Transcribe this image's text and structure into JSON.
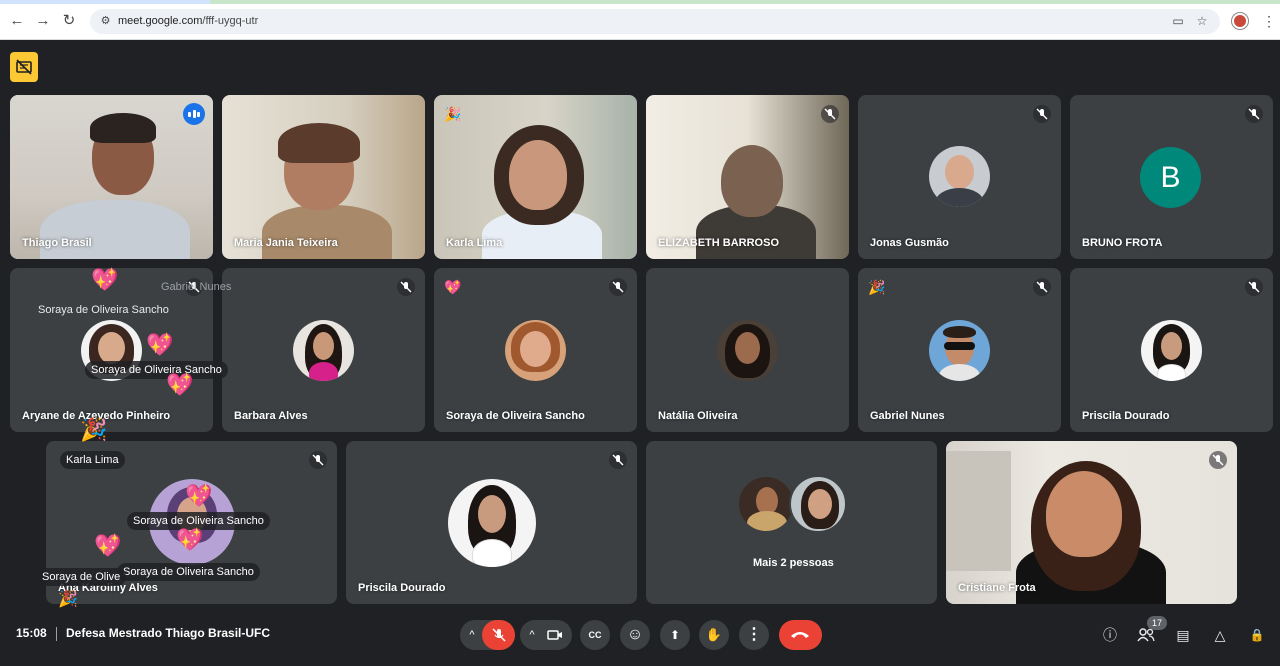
{
  "browser": {
    "url_host": "meet.google.com",
    "url_path": "/fff-uygq-utr",
    "back_icon": "←",
    "forward_icon": "→",
    "reload_icon": "↻",
    "site_info_icon": "⚙",
    "camera_icon": "▭",
    "star_icon": "☆",
    "kebab_icon": "⋮"
  },
  "tiles": {
    "r1": [
      "Thiago Brasil",
      "Maria Jania Teixeira",
      "Karla Lima",
      "ELIZABETH BARROSO",
      "Jonas Gusmão",
      "BRUNO FROTA"
    ],
    "r2": [
      "Aryane de Azevedo Pinheiro",
      "Barbara Alves",
      "Soraya de Oliveira Sancho",
      "Natália Oliveira",
      "Gabriel Nunes",
      "Priscila Dourado"
    ],
    "r3": [
      "Ana Karoliny Alves",
      "Priscila Dourado",
      "Mais 2 pessoas",
      "Cristiane Frota"
    ],
    "bruno_initial": "B"
  },
  "reactions": {
    "party": "🎉",
    "heart": "💖"
  },
  "floaters": {
    "a": "Soraya de Oliveira Sancho",
    "b": "Gabriel Nunes",
    "c": "Soraya de Oliveira Sancho",
    "d": "Karla Lima",
    "e": "Soraya de Oliveira Sancho",
    "f": "Soraya de Olive",
    "g": "Soraya de Oliveira Sancho"
  },
  "bottom_bar": {
    "time": "15:08",
    "meeting_title": "Defesa Mestrado Thiago Brasil-UFC",
    "participants_count": "17",
    "caret": "^",
    "more_icon": "⋮",
    "info_icon": "ⓘ",
    "chat_icon": "▤",
    "activities_icon": "△",
    "lock_icon": "🔒",
    "emoji_icon": "☺",
    "hand_icon": "✋",
    "present_icon": "⬆",
    "cc_label": "CC"
  },
  "colors": {
    "meet_bg": "#202124",
    "tile_bg": "#3c4043",
    "mic_off_red": "#ea4335",
    "speaking_blue": "#1a73e8",
    "bruno_avatar": "#00897b",
    "recording_yellow": "#fcc934"
  }
}
